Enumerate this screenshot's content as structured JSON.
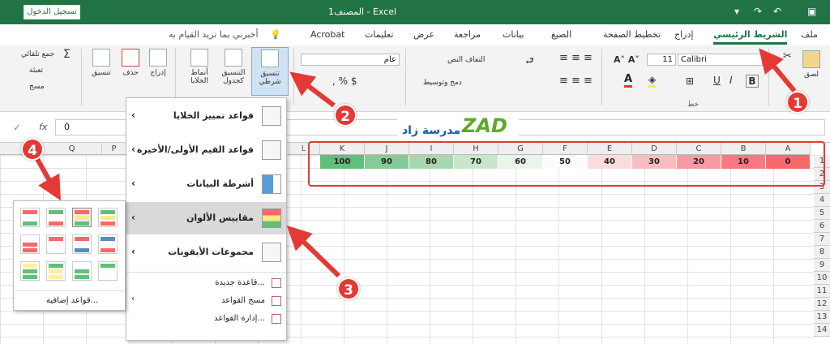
{
  "titlebar": {
    "signin": "تسجيل الدخول",
    "title": "المصنف1 - Excel",
    "save_icon": "save-icon"
  },
  "tabs": [
    "ملف",
    "الشريط الرئيسي",
    "إدراج",
    "تخطيط الصفحة",
    "الصيغ",
    "بيانات",
    "مراجعة",
    "عرض",
    "تعليمات",
    "Acrobat",
    "أخبرني بما تريد القيام به"
  ],
  "ribbon": {
    "paste": "لصق",
    "font_name": "Calibri",
    "font_size": "11",
    "font_group": "خط",
    "wrap_text": "التفاف النص",
    "merge_center": "دمج وتوسيط",
    "number_format": "عام",
    "cond_format": "تنسيق شرطي",
    "format_table": "التنسيق كجدول",
    "cell_styles": "أنماط الخلايا",
    "insert": "إدراج",
    "delete": "حذف",
    "format": "تنسيق",
    "autosum": "جمع تلقائي",
    "fill": "تعبئة",
    "clear": "مسح"
  },
  "formula": {
    "value": "0",
    "fx": "fx"
  },
  "logo": {
    "text": "مدرسة زاد",
    "mark": "ZAD"
  },
  "columns": [
    "K",
    "J",
    "I",
    "H",
    "G",
    "F",
    "E",
    "D",
    "C",
    "B",
    "A"
  ],
  "left_columns": [
    "Q",
    "P"
  ],
  "row_numbers": [
    "1",
    "2",
    "3",
    "4",
    "5",
    "6",
    "7",
    "8",
    "9",
    "10",
    "11",
    "12",
    "13",
    "14"
  ],
  "cells": [
    {
      "value": "100",
      "color": "#63be7b"
    },
    {
      "value": "90",
      "color": "#85cb96"
    },
    {
      "value": "80",
      "color": "#a6d8b0"
    },
    {
      "value": "70",
      "color": "#c8e6cb"
    },
    {
      "value": "60",
      "color": "#e9f4ea"
    },
    {
      "value": "50",
      "color": "#fcfcff"
    },
    {
      "value": "40",
      "color": "#fbdde0"
    },
    {
      "value": "30",
      "color": "#f9bcc1"
    },
    {
      "value": "20",
      "color": "#f89aa1"
    },
    {
      "value": "10",
      "color": "#f77982"
    },
    {
      "value": "0",
      "color": "#f8696b"
    }
  ],
  "cf_menu": {
    "items": [
      "قواعد تمييز الخلايا",
      "قواعد القيم الأولى/الأخيرة",
      "أشرطة البيانات",
      "مقاييس الألوان",
      "مجموعات الأيقونات"
    ],
    "small_items": [
      "قاعدة جديدة...",
      "مسح القواعد",
      "إدارة القواعد..."
    ]
  },
  "scale_menu": {
    "more_rules": "قواعد إضافية..."
  },
  "callouts": [
    "1",
    "2",
    "3",
    "4"
  ],
  "colors": {
    "excel_green": "#217346",
    "callout_red": "#e53935"
  }
}
